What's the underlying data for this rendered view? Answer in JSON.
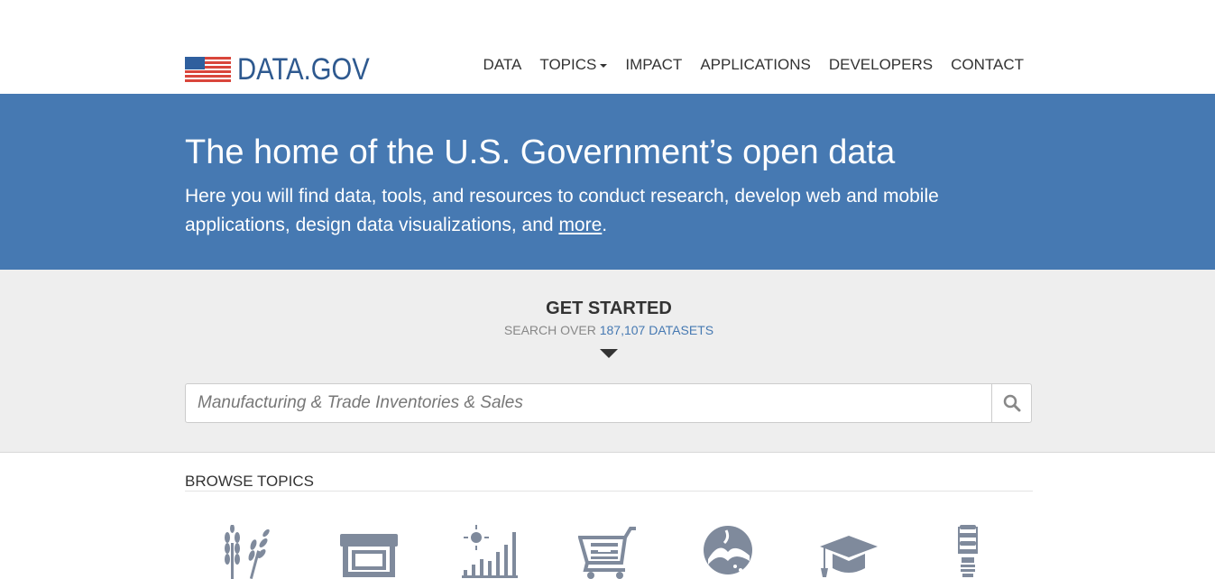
{
  "header": {
    "logo_text": "DATA.GOV",
    "nav": [
      {
        "label": "DATA"
      },
      {
        "label": "TOPICS",
        "has_dropdown": true
      },
      {
        "label": "IMPACT"
      },
      {
        "label": "APPLICATIONS"
      },
      {
        "label": "DEVELOPERS"
      },
      {
        "label": "CONTACT"
      }
    ]
  },
  "hero": {
    "title": "The home of the U.S. Government’s open data",
    "subtitle_before": "Here you will find data, tools, and resources to conduct research, develop web and mobile applications, design data visualizations, and ",
    "subtitle_link": "more",
    "subtitle_after": "."
  },
  "get_started": {
    "title": "GET STARTED",
    "sub_prefix": "SEARCH OVER ",
    "dataset_count": "187,107 DATASETS",
    "search_placeholder": "Manufacturing & Trade Inventories & Sales"
  },
  "browse": {
    "title": "BROWSE TOPICS",
    "topics": [
      {
        "icon": "agriculture-icon"
      },
      {
        "icon": "business-icon"
      },
      {
        "icon": "climate-icon"
      },
      {
        "icon": "consumer-icon"
      },
      {
        "icon": "ecosystems-icon"
      },
      {
        "icon": "education-icon"
      },
      {
        "icon": "energy-icon"
      }
    ]
  },
  "colors": {
    "brand_blue": "#4679b2",
    "logo_blue": "#2e598f",
    "icon_gray": "#7f8a9c"
  }
}
